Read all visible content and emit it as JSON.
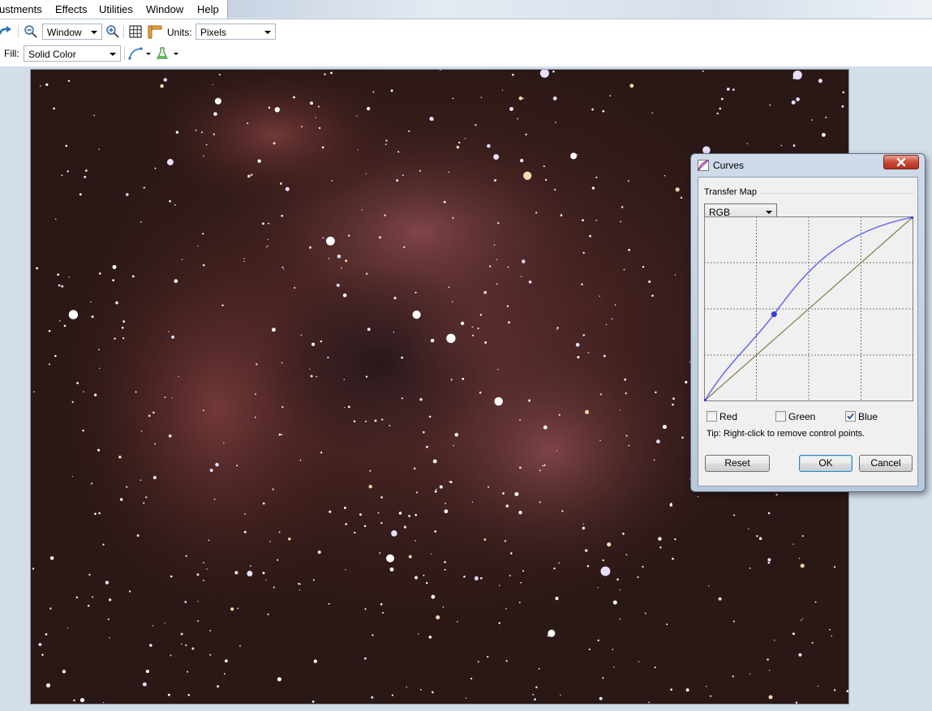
{
  "menu": {
    "items": [
      "ustments",
      "Effects",
      "Utilities",
      "Window",
      "Help"
    ]
  },
  "toolbar": {
    "zoom_value": "Window",
    "units_label": "Units:",
    "units_value": "Pixels",
    "fill_label": "Fill:",
    "fill_value": "Solid Color"
  },
  "dialog": {
    "title": "Curves",
    "group_label": "Transfer Map",
    "mode_value": "RGB",
    "channels": [
      {
        "label": "Red",
        "checked": false
      },
      {
        "label": "Green",
        "checked": false
      },
      {
        "label": "Blue",
        "checked": true
      }
    ],
    "tip": "Tip: Right-click to remove control points.",
    "reset_label": "Reset",
    "ok_label": "OK",
    "cancel_label": "Cancel",
    "curve": {
      "range": [
        0,
        255
      ],
      "control_points": [
        [
          0,
          0
        ],
        [
          85,
          120
        ],
        [
          255,
          255
        ]
      ],
      "curve_color": "#6f6ff5",
      "identity_color": "#8a7b4c"
    }
  },
  "colors": {
    "accent": "#3c7fb1",
    "close_button": "#c94a36",
    "canvas_bg": "#231513"
  }
}
